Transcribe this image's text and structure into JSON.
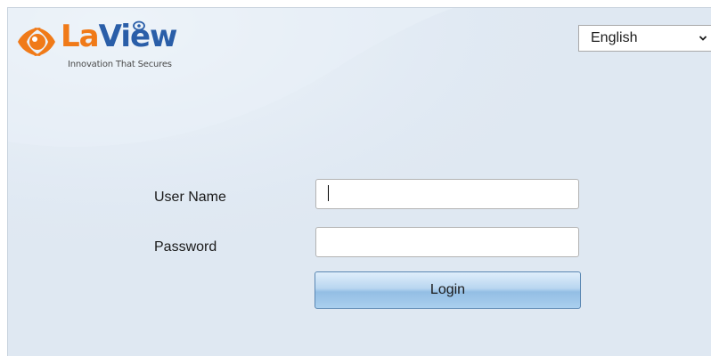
{
  "brand": {
    "name_part1": "La",
    "name_part2": "View",
    "tagline": "Innovation That Secures",
    "colors": {
      "orange": "#f07a18",
      "blue": "#2a5ea8"
    }
  },
  "language_select": {
    "selected": "English",
    "icon": "chevron-down-icon"
  },
  "login_form": {
    "username_label": "User Name",
    "username_value": "",
    "password_label": "Password",
    "password_value": "",
    "login_button_label": "Login"
  },
  "colors": {
    "panel_background": "#dfe8f2",
    "button_border": "#5a87b3"
  }
}
